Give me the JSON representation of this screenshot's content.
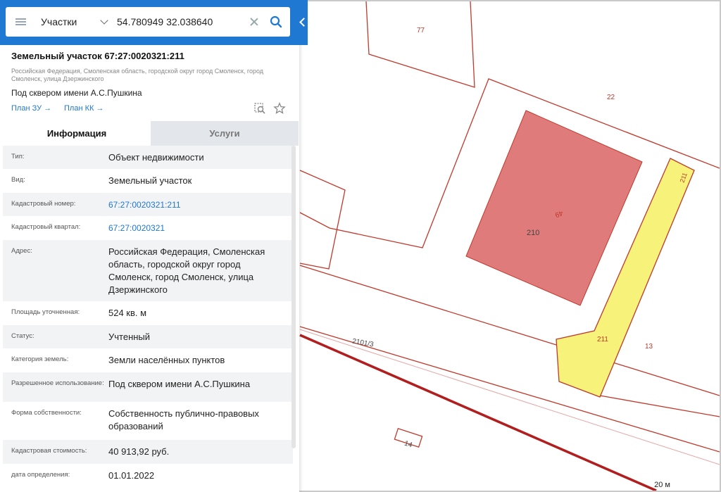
{
  "search": {
    "layer": "Участки",
    "query": "54.780949 32.038640"
  },
  "parcel": {
    "title": "Земельный участок 67:27:0020321:211",
    "address_short": "Российская Федерация, Смоленская область, городской округ город Смоленск, город Смоленск, улица Дзержинского",
    "description": "Под сквером имени А.С.Пушкина",
    "plan_zu": "План ЗУ →",
    "plan_kk": "План КК →"
  },
  "tabs": {
    "info": "Информация",
    "services": "Услуги"
  },
  "rows": [
    {
      "label": "Тип:",
      "value": "Объект недвижимости"
    },
    {
      "label": "Вид:",
      "value": "Земельный участок"
    },
    {
      "label": "Кадастровый номер:",
      "value": "67:27:0020321:211"
    },
    {
      "label": "Кадастровый квартал:",
      "value": "67:27:0020321"
    },
    {
      "label": "Адрес:",
      "value": "Российская Федерация, Смоленская область, городской округ город Смоленск, город Смоленск, улица Дзержинского"
    },
    {
      "label": "Площадь уточненная:",
      "value": "524 кв. м"
    },
    {
      "label": "Статус:",
      "value": "Учтенный"
    },
    {
      "label": "Категория земель:",
      "value": "Земли населённых пунктов"
    },
    {
      "label": "Разрешенное использование:",
      "value": "Под сквером имени А.С.Пушкина"
    },
    {
      "label": "Форма собственности:",
      "value": "Собственность публично-правовых образований"
    },
    {
      "label": "Кадастровая стоимость:",
      "value": "40 913,92 руб."
    },
    {
      "label": "дата определения:",
      "value": "01.01.2022"
    }
  ],
  "map": {
    "labels": {
      "l77": "77",
      "l22": "22",
      "l211_top": "211",
      "l49": "49",
      "l210": "210",
      "l2101": "2101/3",
      "l211_mid": "211",
      "l13": "13",
      "l14": "14"
    },
    "scale": "20 м"
  },
  "colors": {
    "accent": "#1f78d1",
    "parcel_fill": "#e07b7b",
    "selected_fill": "#f7f27a",
    "boundary": "#c0392b"
  }
}
